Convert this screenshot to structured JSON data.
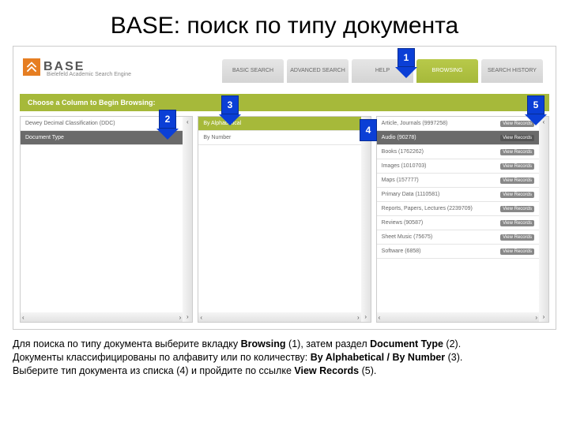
{
  "title": "BASE: поиск по типу документа",
  "logo": {
    "text": "BASE",
    "sub": "Bielefeld Academic Search Engine"
  },
  "tabs": [
    {
      "label": "BASIC\nSEARCH"
    },
    {
      "label": "ADVANCED\nSEARCH"
    },
    {
      "label": "HELP"
    },
    {
      "label": "BROWSING",
      "active": true
    },
    {
      "label": "SEARCH\nHISTORY"
    }
  ],
  "choose_bar": "Choose a Column to Begin Browsing:",
  "panel1": {
    "rows": [
      {
        "label": "Dewey Decimal Classification (DDC)"
      },
      {
        "label": "Document Type",
        "selected": true
      }
    ]
  },
  "panel2": {
    "rows": [
      {
        "label": "By Alphabetical",
        "alt": true
      },
      {
        "label": "By Number"
      }
    ]
  },
  "panel3": {
    "rows": [
      {
        "label": "Article, Journals (9997258)",
        "view": "View Records"
      },
      {
        "label": "Audio (90278)",
        "view": "View Records",
        "selected": true
      },
      {
        "label": "Books (1762262)",
        "view": "View Records"
      },
      {
        "label": "Images (1010703)",
        "view": "View Records"
      },
      {
        "label": "Maps (157777)",
        "view": "View Records"
      },
      {
        "label": "Primary Data (1110581)",
        "view": "View Records"
      },
      {
        "label": "Reports, Papers, Lectures (2239709)",
        "view": "View Records"
      },
      {
        "label": "Reviews (90587)",
        "view": "View Records"
      },
      {
        "label": "Sheet Music (75675)",
        "view": "View Records"
      },
      {
        "label": "Software (6858)",
        "view": "View Records"
      }
    ]
  },
  "callouts": {
    "c1": "1",
    "c2": "2",
    "c3": "3",
    "c4": "4",
    "c5": "5"
  },
  "caption": {
    "l1a": "Для поиска по типу документа выберите вкладку ",
    "l1b": "Browsing",
    "l1c": " (1), затем раздел ",
    "l1d": "Document Type",
    "l1e": " (2).",
    "l2a": "Документы классифицированы по алфавиту или по количеству: ",
    "l2b": "By Alphabetical / By Number",
    "l2c": " (3).",
    "l3a": "Выберите тип документа из списка (4) и пройдите по ссылке ",
    "l3b": "View Records",
    "l3c": " (5)."
  }
}
